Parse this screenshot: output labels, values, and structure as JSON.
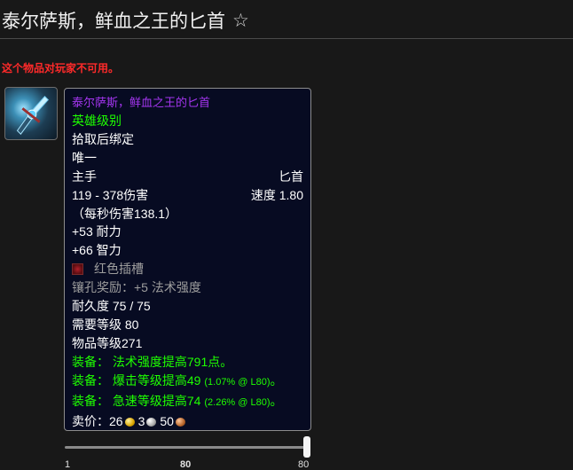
{
  "page": {
    "title": "泰尔萨斯，鲜血之王的匕首",
    "favorite_icon": "star-outline-icon",
    "warning": "这个物品对玩家不可用。"
  },
  "tooltip": {
    "name": "泰尔萨斯，鲜血之王的匕首",
    "quality": "英雄级别",
    "bind": "拾取后绑定",
    "unique": "唯一",
    "slot": "主手",
    "type": "匕首",
    "damage": "119 - 378伤害",
    "speed": "速度 1.80",
    "dps": "（每秒伤害138.1）",
    "stamina": "+53 耐力",
    "intellect": "+66 智力",
    "socket": "红色插槽",
    "socket_bonus": "镶孔奖励：+5 法术强度",
    "durability": "耐久度 75 / 75",
    "required_level": "需要等级 80",
    "item_level": "物品等级271",
    "equip_prefix": "装备：",
    "equip1": "法术强度提高791点。",
    "equip2": "爆击等级提高49",
    "equip2_detail": "(1.07% @ L80)",
    "equip3": "急速等级提高74",
    "equip3_detail": "(2.26% @ L80)",
    "period": "。",
    "sell_label": "卖价：",
    "gold": "26",
    "silver": "3",
    "copper": "50"
  },
  "level_slider": {
    "min": "1",
    "current": "80",
    "max": "80",
    "value": 80
  },
  "colors": {
    "epic": "#a335ee",
    "uncommon": "#1eff00",
    "warning": "#ff2a2a",
    "tooltip_bg": "#070b22"
  }
}
